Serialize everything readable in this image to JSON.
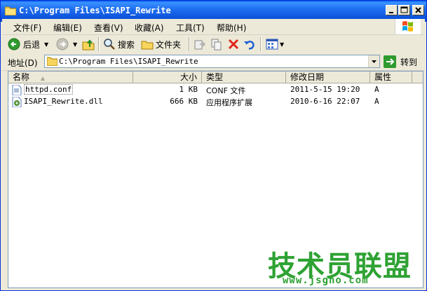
{
  "window": {
    "title": "C:\\Program Files\\ISAPI_Rewrite"
  },
  "menu": {
    "items": [
      "文件(F)",
      "编辑(E)",
      "查看(V)",
      "收藏(A)",
      "工具(T)",
      "帮助(H)"
    ]
  },
  "toolbar": {
    "back_label": "后退",
    "search_label": "搜索",
    "folders_label": "文件夹"
  },
  "address": {
    "label": "地址(D)",
    "value": "C:\\Program Files\\ISAPI_Rewrite",
    "go_label": "转到"
  },
  "list": {
    "columns": [
      "名称",
      "大小",
      "类型",
      "修改日期",
      "属性"
    ],
    "rows": [
      {
        "name": "httpd.conf",
        "size": "1 KB",
        "type": "CONF 文件",
        "modified": "2011-5-15 19:20",
        "attr": "A"
      },
      {
        "name": "ISAPI_Rewrite.dll",
        "size": "666 KB",
        "type": "应用程序扩展",
        "modified": "2010-6-16 22:07",
        "attr": "A"
      }
    ]
  },
  "watermark": {
    "title": "技术员联盟",
    "url": "www.jsgho.com"
  },
  "colors": {
    "titlebar": "#0a4fd8",
    "chrome": "#ece9d8",
    "watermark": "#2ea233"
  }
}
